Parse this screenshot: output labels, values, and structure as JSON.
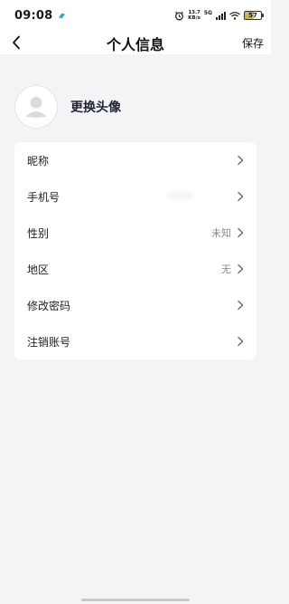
{
  "status_bar": {
    "time": "09:08",
    "net_speed_value": "13.7",
    "net_speed_unit": "KB/s",
    "network_type": "5G",
    "battery_level": "57",
    "battery_fraction": 0.57
  },
  "nav": {
    "title": "个人信息",
    "save_label": "保存",
    "back_icon": "chevron-left-icon"
  },
  "profile": {
    "avatar_icon": "default-avatar-icon",
    "change_avatar_label": "更换头像"
  },
  "settings": [
    {
      "label": "昵称",
      "value": ""
    },
    {
      "label": "手机号",
      "value": ""
    },
    {
      "label": "性别",
      "value": "未知"
    },
    {
      "label": "地区",
      "value": "无"
    },
    {
      "label": "修改密码",
      "value": ""
    },
    {
      "label": "注销账号",
      "value": ""
    }
  ],
  "colors": {
    "page_background": "#f4f4f6",
    "card_background": "#ffffff",
    "value_text": "#888888",
    "battery_fill": "#c9b74f"
  }
}
